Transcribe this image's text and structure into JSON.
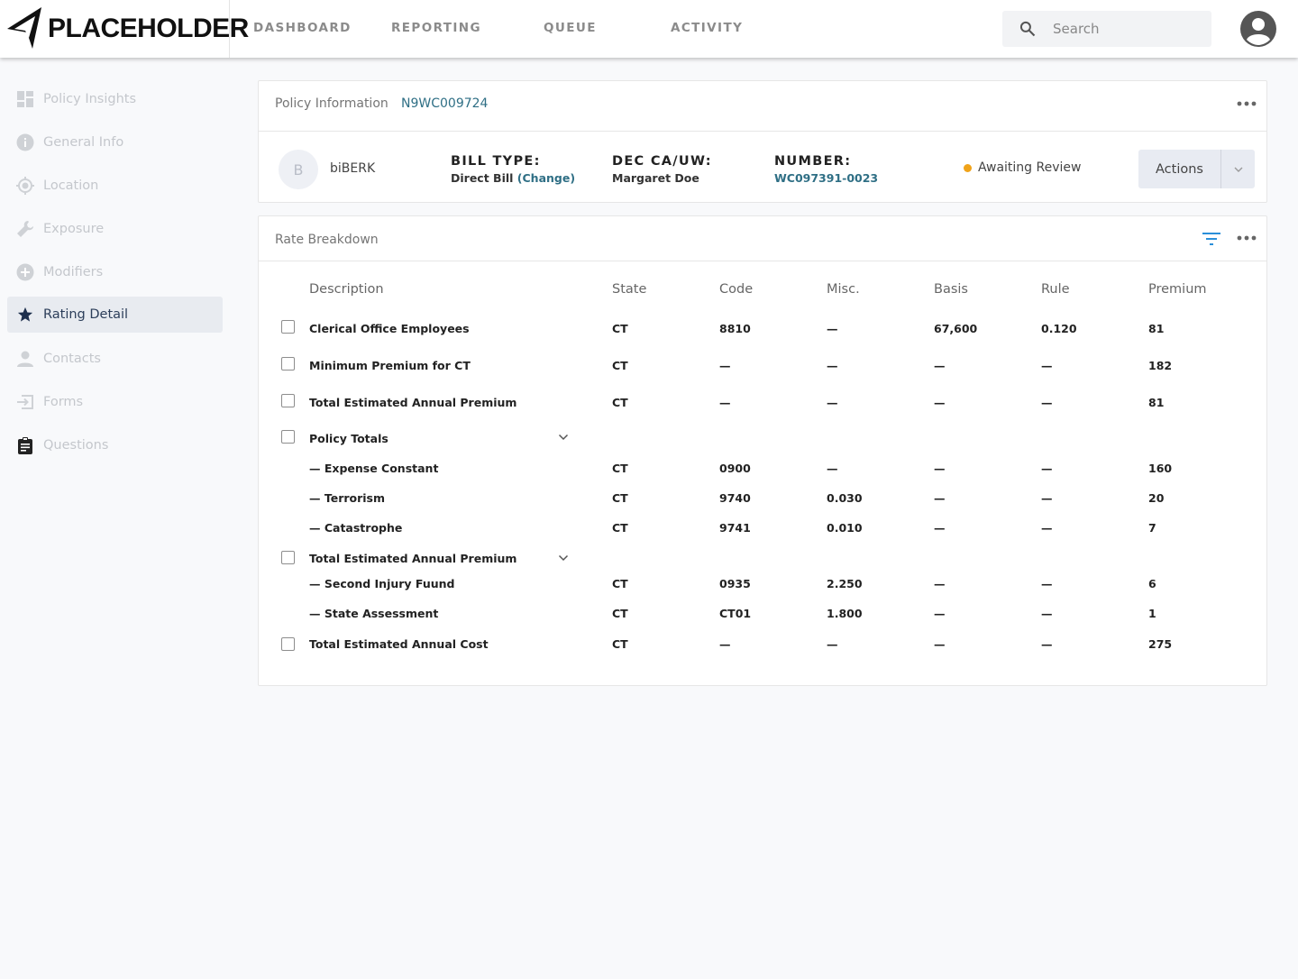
{
  "brand": {
    "name": "PLACEHOLDER"
  },
  "nav": {
    "dashboard": "DASHBOARD",
    "reporting": "REPORTING",
    "queue": "QUEUE",
    "activity": "ACTIVITY"
  },
  "search": {
    "placeholder": "Search",
    "value": ""
  },
  "sidebar": {
    "items": [
      {
        "label": "Policy Insights",
        "icon": "dashboard-icon"
      },
      {
        "label": "General Info",
        "icon": "info-icon"
      },
      {
        "label": "Location",
        "icon": "location-icon"
      },
      {
        "label": "Exposure",
        "icon": "wrench-icon"
      },
      {
        "label": "Modifiers",
        "icon": "add-circle-icon"
      },
      {
        "label": "Rating Detail",
        "icon": "star-icon",
        "active": true
      },
      {
        "label": "Contacts",
        "icon": "person-icon"
      },
      {
        "label": "Forms",
        "icon": "input-icon"
      },
      {
        "label": "Questions",
        "icon": "clipboard-icon"
      }
    ]
  },
  "policy_card": {
    "title": "Policy Information",
    "policy_id": "N9WC009724",
    "avatar_letter": "B",
    "company": "biBERK",
    "bill_type": {
      "label": "BILL TYPE:",
      "value": "Direct Bill",
      "change": "(Change)"
    },
    "dec": {
      "label": "DEC CA/UW:",
      "value": "Margaret Doe"
    },
    "number": {
      "label": "NUMBER:",
      "value": "WC097391-0023"
    },
    "status": {
      "text": "Awaiting Review",
      "color": "#f0a31a"
    },
    "actions_label": "Actions"
  },
  "rate_card": {
    "title": "Rate Breakdown",
    "columns": [
      "Description",
      "State",
      "Code",
      "Misc.",
      "Basis",
      "Rule",
      "Premium"
    ],
    "rows": [
      {
        "description": "Clerical Office Employees",
        "state": "CT",
        "code": "8810",
        "misc": "—",
        "basis": "67,600",
        "rule": "0.120",
        "premium": "81"
      },
      {
        "description": "Minimum Premium for CT",
        "state": "CT",
        "code": "—",
        "misc": "—",
        "basis": "—",
        "rule": "—",
        "premium": "182"
      },
      {
        "description": "Total Estimated Annual Premium",
        "state": "CT",
        "code": "—",
        "misc": "—",
        "basis": "—",
        "rule": "—",
        "premium": "81"
      },
      {
        "description": "Policy Totals",
        "group": true
      },
      {
        "description": "— Expense Constant",
        "state": "CT",
        "code": "0900",
        "misc": "—",
        "basis": "—",
        "rule": "—",
        "premium": "160"
      },
      {
        "description": "— Terrorism",
        "state": "CT",
        "code": "9740",
        "misc": "0.030",
        "basis": "—",
        "rule": "—",
        "premium": "20"
      },
      {
        "description": "— Catastrophe",
        "state": "CT",
        "code": "9741",
        "misc": "0.010",
        "basis": "—",
        "rule": "—",
        "premium": "7"
      },
      {
        "description": "Total Estimated Annual Premium",
        "group": true
      },
      {
        "description": "— Second Injury Fuund",
        "state": "CT",
        "code": "0935",
        "misc": "2.250",
        "basis": "—",
        "rule": "—",
        "premium": "6"
      },
      {
        "description": "— State Assessment",
        "state": "CT",
        "code": "CT01",
        "misc": "1.800",
        "basis": "—",
        "rule": "—",
        "premium": "1"
      },
      {
        "description": "Total Estimated Annual Cost",
        "state": "CT",
        "code": "—",
        "misc": "—",
        "basis": "—",
        "rule": "—",
        "premium": "275"
      }
    ]
  }
}
